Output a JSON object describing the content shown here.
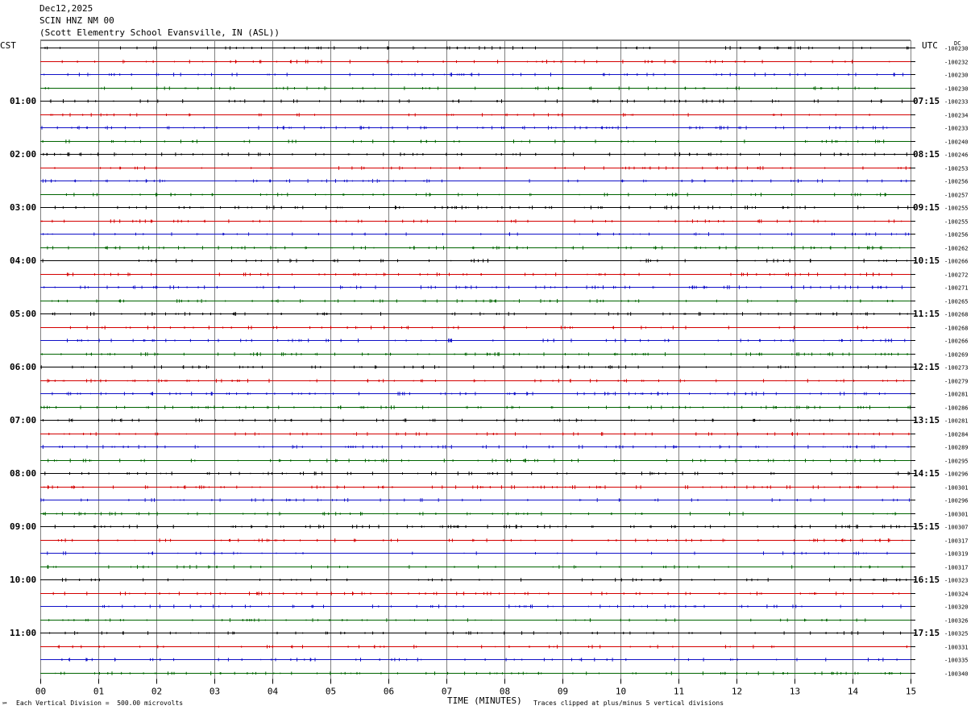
{
  "header": {
    "date": "Dec12,2025",
    "station": "SCIN HNZ NM 00",
    "location": "(Scott Elementry School Evansville, IN (ASL))"
  },
  "labels": {
    "left_timezone": "CST",
    "right_timezone": "UTC",
    "dc": "DC",
    "xlabel": "TIME (MINUTES)",
    "division_note": "Each Vertical Division =  500.00 microvolts",
    "clip_note": "Traces clipped at plus/minus 5 vertical divisions",
    "corner_mark": "℠"
  },
  "colors": {
    "trace_cycle": [
      "#000000",
      "#d40000",
      "#1010c8",
      "#006400"
    ],
    "grid": "#808080"
  },
  "chart_data": {
    "type": "line",
    "title": "",
    "xlabel": "TIME (MINUTES)",
    "xlim": [
      0,
      15
    ],
    "x_ticks": [
      "00",
      "01",
      "02",
      "03",
      "04",
      "05",
      "06",
      "07",
      "08",
      "09",
      "10",
      "11",
      "12",
      "13",
      "14",
      "15"
    ],
    "row_count": 48,
    "left_hour_labels": [
      "01:00",
      "02:00",
      "03:00",
      "04:00",
      "05:00",
      "06:00",
      "07:00",
      "08:00",
      "09:00",
      "10:00",
      "11:00"
    ],
    "right_hour_labels": [
      "07:15",
      "08:15",
      "09:15",
      "10:15",
      "11:15",
      "12:15",
      "13:15",
      "14:15",
      "15:15",
      "16:15",
      "17:15"
    ],
    "dc_offsets": [
      "-100230",
      "-100232",
      "-100230",
      "-100230",
      "-100233",
      "-100234",
      "-100233",
      "-100240",
      "-100246",
      "-100253",
      "-100256",
      "-100257",
      "-100255",
      "-100255",
      "-100256",
      "-100262",
      "-100266",
      "-100272",
      "-100271",
      "-100265",
      "-100268",
      "-100268",
      "-100266",
      "-100269",
      "-100273",
      "-100279",
      "-100281",
      "-100286",
      "-100281",
      "-100284",
      "-100289",
      "-100295",
      "-100296",
      "-100301",
      "-100296",
      "-100301",
      "-100307",
      "-100317",
      "-100319",
      "-100317",
      "-100323",
      "-100324",
      "-100320",
      "-100326",
      "-100325",
      "-100331",
      "-100335",
      "-100340"
    ]
  }
}
